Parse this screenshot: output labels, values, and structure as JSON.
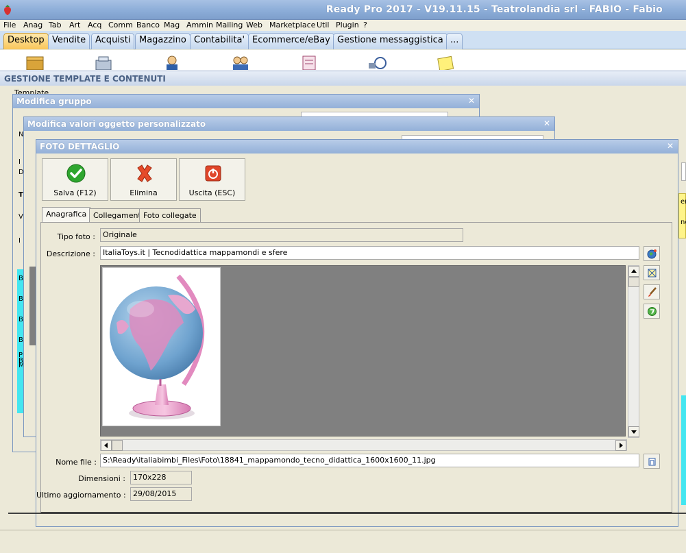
{
  "app": {
    "title": "Ready Pro 2017 - V19.11.15 - Teatrolandia srl - FABIO - Fabio"
  },
  "menu": [
    "File",
    "Anag",
    "Tab",
    "Art",
    "Acq",
    "Comm",
    "Banco",
    "Mag",
    "Ammin",
    "Mailing",
    "Web",
    "Marketplace",
    "Util",
    "Plugin",
    "?"
  ],
  "main_tabs": [
    "Desktop",
    "Vendite",
    "Acquisti",
    "Magazzino",
    "Contabilita'",
    "Ecommerce/eBay",
    "Gestione messaggistica",
    "..."
  ],
  "panel": {
    "title": "GESTIONE TEMPLATE E CONTENUTI",
    "template_label": "Template"
  },
  "dialogs": {
    "group": "Modifica gruppo",
    "custom_obj": "Modifica valori oggetto personalizzato",
    "photo": "FOTO DETTAGLIO"
  },
  "buttons": {
    "save": "Salva (F12)",
    "delete": "Elimina",
    "exit": "Uscita (ESC)"
  },
  "sub_tabs": [
    "Anagrafica",
    "Collegamenti",
    "Foto collegate"
  ],
  "form": {
    "tipo_foto_label": "Tipo foto :",
    "tipo_foto": "Originale",
    "descrizione_label": "Descrizione :",
    "descrizione": "ItaliaToys.it | Tecnodidattica mappamondi e sfere",
    "nome_file_label": "Nome file :",
    "nome_file": "S:\\Ready\\italiabimbi_Files\\Foto\\18841_mappamondo_tecno_didattica_1600x1600_11.jpg",
    "dimensioni_label": "Dimensioni :",
    "dimensioni": "170x228",
    "ultimo_label": "Ultimo aggiornamento :",
    "ultimo": "29/08/2015"
  },
  "side_icons": [
    "globe-picker-icon",
    "crop-icon",
    "brush-icon",
    "recycle-icon"
  ],
  "file_browse_icon": "file-browse-icon",
  "bg_letters": [
    "N",
    "I",
    "D",
    "T",
    "V",
    "I",
    "B",
    "B",
    "B",
    "B",
    "B",
    "P",
    "M"
  ],
  "right_edge_letters": [
    "er",
    "ne"
  ],
  "colors": {
    "title_bar": "#8CADD8",
    "active_tab": "#F9C659",
    "image_bg": "#808080"
  }
}
